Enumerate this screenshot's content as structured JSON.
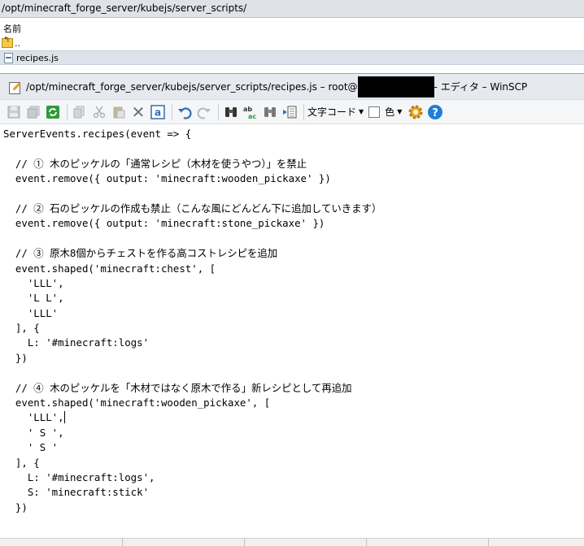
{
  "explorer": {
    "path": "/opt/minecraft_forge_server/kubejs/server_scripts/",
    "column_name": "名前",
    "parent_label": "..",
    "file_name": "recipes.js"
  },
  "editor": {
    "title_prefix": "/opt/minecraft_forge_server/kubejs/server_scripts/recipes.js – root@",
    "title_suffix": "- エディタ – WinSCP",
    "toolbar": {
      "encoding_label": "文字コード",
      "color_label": "色",
      "icons": [
        "save-icon",
        "save-all-icon",
        "reload-icon",
        "copy-icon",
        "cut-icon",
        "paste-icon",
        "delete-icon",
        "select-all-icon",
        "undo-icon",
        "redo-icon",
        "find-icon",
        "replace-icon",
        "find-next-icon",
        "goto-line-icon",
        "settings-icon",
        "help-icon"
      ]
    },
    "code_lines": [
      "ServerEvents.recipes(event => {",
      "",
      "  // ① 木のピッケルの「通常レシピ（木材を使うやつ）」を禁止",
      "  event.remove({ output: 'minecraft:wooden_pickaxe' })",
      "",
      "  // ② 石のピッケルの作成も禁止（こんな風にどんどん下に追加していきます）",
      "  event.remove({ output: 'minecraft:stone_pickaxe' })",
      "",
      "  // ③ 原木8個からチェストを作る高コストレシピを追加",
      "  event.shaped('minecraft:chest', [",
      "    'LLL',",
      "    'L L',",
      "    'LLL'",
      "  ], {",
      "    L: '#minecraft:logs'",
      "  })",
      "",
      "  // ④ 木のピッケルを「木材ではなく原木で作る」新レシピとして再追加",
      "  event.shaped('minecraft:wooden_pickaxe', [",
      "    'LLL',",
      "    ' S ',",
      "    ' S '",
      "  ], {",
      "    L: '#minecraft:logs',",
      "    S: 'minecraft:stick'",
      "  })"
    ]
  }
}
